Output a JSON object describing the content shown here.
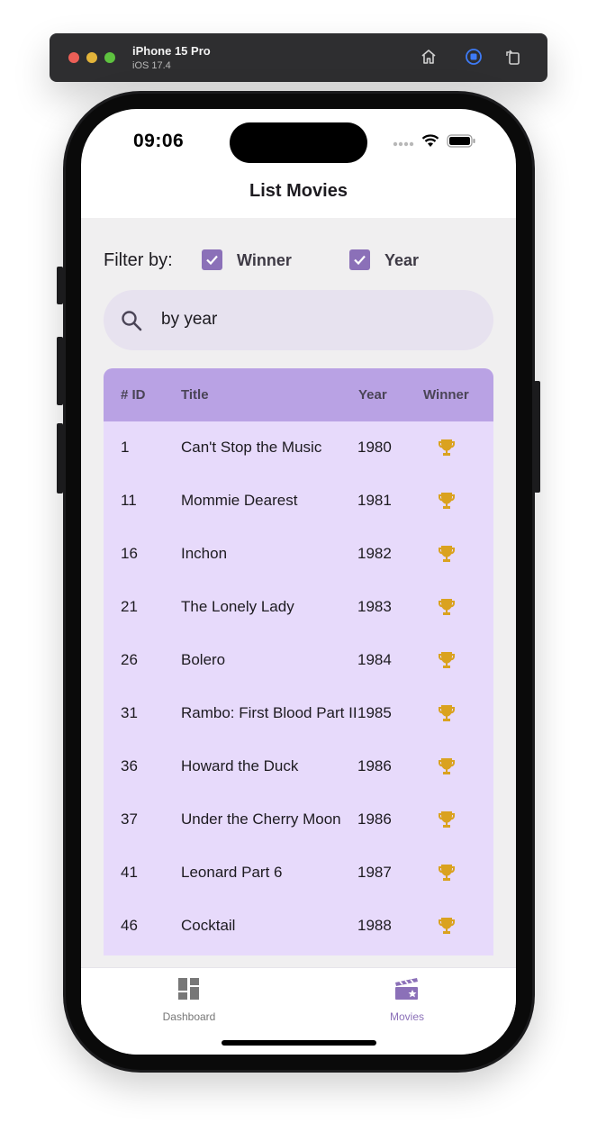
{
  "simulator": {
    "device_name": "iPhone 15 Pro",
    "os_version": "iOS 17.4",
    "icons": [
      "home-icon",
      "screenshot-icon",
      "rotate-icon"
    ]
  },
  "status_bar": {
    "time": "09:06"
  },
  "app_bar": {
    "title": "List Movies"
  },
  "filter": {
    "label": "Filter by:",
    "options": [
      {
        "label": "Winner",
        "checked": true
      },
      {
        "label": "Year",
        "checked": true
      }
    ]
  },
  "search": {
    "value": "by year",
    "icon": "search-icon"
  },
  "table": {
    "headers": {
      "id": "# ID",
      "title": "Title",
      "year": "Year",
      "winner": "Winner"
    },
    "rows": [
      {
        "id": "1",
        "title": "Can't Stop the Music",
        "year": "1980",
        "winner": true
      },
      {
        "id": "11",
        "title": "Mommie Dearest",
        "year": "1981",
        "winner": true
      },
      {
        "id": "16",
        "title": "Inchon",
        "year": "1982",
        "winner": true
      },
      {
        "id": "21",
        "title": "The Lonely Lady",
        "year": "1983",
        "winner": true
      },
      {
        "id": "26",
        "title": "Bolero",
        "year": "1984",
        "winner": true
      },
      {
        "id": "31",
        "title": "Rambo: First Blood Part II",
        "year": "1985",
        "winner": true
      },
      {
        "id": "36",
        "title": "Howard the Duck",
        "year": "1986",
        "winner": true
      },
      {
        "id": "37",
        "title": "Under the Cherry Moon",
        "year": "1986",
        "winner": true
      },
      {
        "id": "41",
        "title": "Leonard Part 6",
        "year": "1987",
        "winner": true
      },
      {
        "id": "46",
        "title": "Cocktail",
        "year": "1988",
        "winner": true
      }
    ]
  },
  "bottom_nav": {
    "items": [
      {
        "label": "Dashboard",
        "icon": "dashboard-icon",
        "active": false
      },
      {
        "label": "Movies",
        "icon": "movies-icon",
        "active": true
      }
    ]
  },
  "colors": {
    "accent": "#8b70b8",
    "header_bg": "#b9a2e4",
    "row_bg": "#e7dafb",
    "trophy": "#daa21f",
    "nav_inactive": "#777777"
  }
}
